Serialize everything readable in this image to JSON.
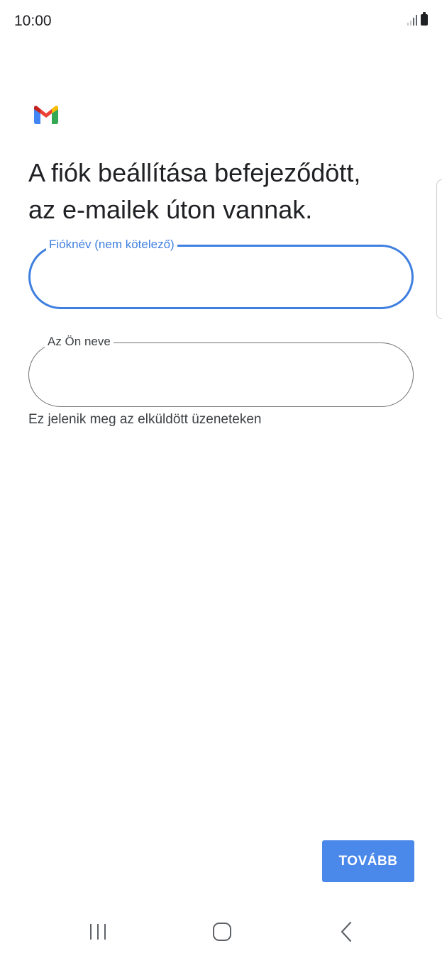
{
  "status_bar": {
    "time": "10:00"
  },
  "colors": {
    "accent": "#3f7fe0",
    "button": "#4a88ea",
    "text": "#202124"
  },
  "icons": {
    "logo": "gmail-logo",
    "signal": "signal-icon",
    "battery": "battery-icon",
    "recents": "recents-icon",
    "home": "home-icon",
    "back": "back-icon"
  },
  "main": {
    "title_line1": "A fiók beállítása befejeződött,",
    "title_line2": "az e-mailek úton vannak.",
    "account_name_field": {
      "label": "Fióknév (nem kötelező)",
      "value": ""
    },
    "your_name_field": {
      "label": "Az Ön neve",
      "value": ""
    },
    "helper_text": "Ez jelenik meg az elküldött üzeneteken",
    "next_button": "TOVÁBB"
  }
}
